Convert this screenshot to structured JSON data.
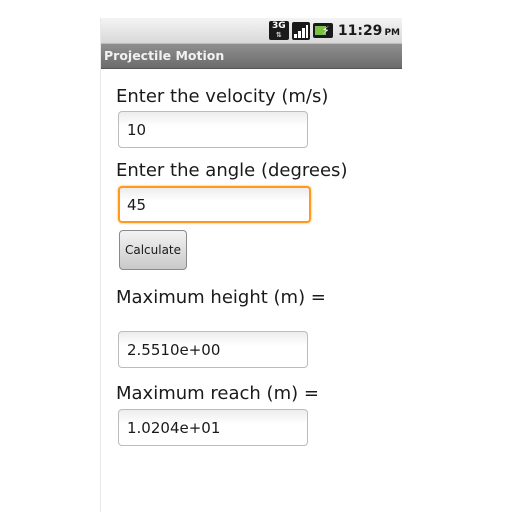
{
  "status_bar": {
    "network_label": "3G",
    "time": "11:29",
    "ampm": "PM",
    "icons": [
      "network-3g-icon",
      "signal-strength-icon",
      "battery-charging-icon"
    ]
  },
  "app": {
    "title": "Projectile Motion"
  },
  "form": {
    "velocity_label": "Enter the velocity (m/s)",
    "velocity_value": "10",
    "angle_label": "Enter the angle (degrees)",
    "angle_value": "45",
    "calculate_label": "Calculate",
    "height_label": "Maximum height (m) =",
    "height_value": "2.5510e+00",
    "reach_label": "Maximum reach (m) =",
    "reach_value": "1.0204e+01"
  },
  "colors": {
    "focus_border": "#ff9a1e",
    "title_bar": "#7c7c7c",
    "battery_charge": "#7ac143"
  }
}
